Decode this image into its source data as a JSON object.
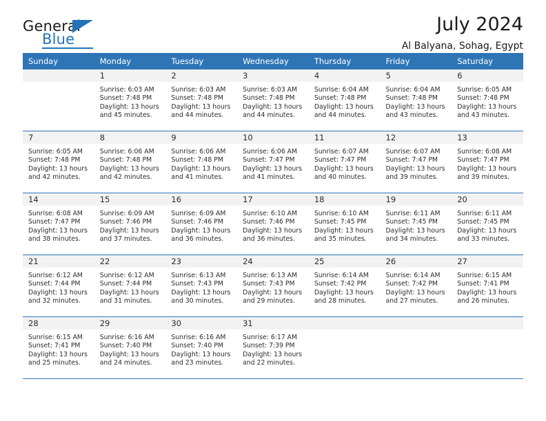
{
  "brand": {
    "name_part1": "General",
    "name_part2": "Blue",
    "accent_color": "#2272b8"
  },
  "header": {
    "title": "July 2024",
    "subtitle": "Al Balyana, Sohag, Egypt"
  },
  "calendar": {
    "header_color": "#2e75b6",
    "daynum_background": "#f2f2f2",
    "weekday_headers": [
      "Sunday",
      "Monday",
      "Tuesday",
      "Wednesday",
      "Thursday",
      "Friday",
      "Saturday"
    ],
    "weeks": [
      [
        {
          "day": "",
          "sunrise": "",
          "sunset": "",
          "daylight1": "",
          "daylight2": ""
        },
        {
          "day": "1",
          "sunrise": "Sunrise: 6:03 AM",
          "sunset": "Sunset: 7:48 PM",
          "daylight1": "Daylight: 13 hours",
          "daylight2": "and 45 minutes."
        },
        {
          "day": "2",
          "sunrise": "Sunrise: 6:03 AM",
          "sunset": "Sunset: 7:48 PM",
          "daylight1": "Daylight: 13 hours",
          "daylight2": "and 44 minutes."
        },
        {
          "day": "3",
          "sunrise": "Sunrise: 6:03 AM",
          "sunset": "Sunset: 7:48 PM",
          "daylight1": "Daylight: 13 hours",
          "daylight2": "and 44 minutes."
        },
        {
          "day": "4",
          "sunrise": "Sunrise: 6:04 AM",
          "sunset": "Sunset: 7:48 PM",
          "daylight1": "Daylight: 13 hours",
          "daylight2": "and 44 minutes."
        },
        {
          "day": "5",
          "sunrise": "Sunrise: 6:04 AM",
          "sunset": "Sunset: 7:48 PM",
          "daylight1": "Daylight: 13 hours",
          "daylight2": "and 43 minutes."
        },
        {
          "day": "6",
          "sunrise": "Sunrise: 6:05 AM",
          "sunset": "Sunset: 7:48 PM",
          "daylight1": "Daylight: 13 hours",
          "daylight2": "and 43 minutes."
        }
      ],
      [
        {
          "day": "7",
          "sunrise": "Sunrise: 6:05 AM",
          "sunset": "Sunset: 7:48 PM",
          "daylight1": "Daylight: 13 hours",
          "daylight2": "and 42 minutes."
        },
        {
          "day": "8",
          "sunrise": "Sunrise: 6:06 AM",
          "sunset": "Sunset: 7:48 PM",
          "daylight1": "Daylight: 13 hours",
          "daylight2": "and 42 minutes."
        },
        {
          "day": "9",
          "sunrise": "Sunrise: 6:06 AM",
          "sunset": "Sunset: 7:48 PM",
          "daylight1": "Daylight: 13 hours",
          "daylight2": "and 41 minutes."
        },
        {
          "day": "10",
          "sunrise": "Sunrise: 6:06 AM",
          "sunset": "Sunset: 7:47 PM",
          "daylight1": "Daylight: 13 hours",
          "daylight2": "and 41 minutes."
        },
        {
          "day": "11",
          "sunrise": "Sunrise: 6:07 AM",
          "sunset": "Sunset: 7:47 PM",
          "daylight1": "Daylight: 13 hours",
          "daylight2": "and 40 minutes."
        },
        {
          "day": "12",
          "sunrise": "Sunrise: 6:07 AM",
          "sunset": "Sunset: 7:47 PM",
          "daylight1": "Daylight: 13 hours",
          "daylight2": "and 39 minutes."
        },
        {
          "day": "13",
          "sunrise": "Sunrise: 6:08 AM",
          "sunset": "Sunset: 7:47 PM",
          "daylight1": "Daylight: 13 hours",
          "daylight2": "and 39 minutes."
        }
      ],
      [
        {
          "day": "14",
          "sunrise": "Sunrise: 6:08 AM",
          "sunset": "Sunset: 7:47 PM",
          "daylight1": "Daylight: 13 hours",
          "daylight2": "and 38 minutes."
        },
        {
          "day": "15",
          "sunrise": "Sunrise: 6:09 AM",
          "sunset": "Sunset: 7:46 PM",
          "daylight1": "Daylight: 13 hours",
          "daylight2": "and 37 minutes."
        },
        {
          "day": "16",
          "sunrise": "Sunrise: 6:09 AM",
          "sunset": "Sunset: 7:46 PM",
          "daylight1": "Daylight: 13 hours",
          "daylight2": "and 36 minutes."
        },
        {
          "day": "17",
          "sunrise": "Sunrise: 6:10 AM",
          "sunset": "Sunset: 7:46 PM",
          "daylight1": "Daylight: 13 hours",
          "daylight2": "and 36 minutes."
        },
        {
          "day": "18",
          "sunrise": "Sunrise: 6:10 AM",
          "sunset": "Sunset: 7:45 PM",
          "daylight1": "Daylight: 13 hours",
          "daylight2": "and 35 minutes."
        },
        {
          "day": "19",
          "sunrise": "Sunrise: 6:11 AM",
          "sunset": "Sunset: 7:45 PM",
          "daylight1": "Daylight: 13 hours",
          "daylight2": "and 34 minutes."
        },
        {
          "day": "20",
          "sunrise": "Sunrise: 6:11 AM",
          "sunset": "Sunset: 7:45 PM",
          "daylight1": "Daylight: 13 hours",
          "daylight2": "and 33 minutes."
        }
      ],
      [
        {
          "day": "21",
          "sunrise": "Sunrise: 6:12 AM",
          "sunset": "Sunset: 7:44 PM",
          "daylight1": "Daylight: 13 hours",
          "daylight2": "and 32 minutes."
        },
        {
          "day": "22",
          "sunrise": "Sunrise: 6:12 AM",
          "sunset": "Sunset: 7:44 PM",
          "daylight1": "Daylight: 13 hours",
          "daylight2": "and 31 minutes."
        },
        {
          "day": "23",
          "sunrise": "Sunrise: 6:13 AM",
          "sunset": "Sunset: 7:43 PM",
          "daylight1": "Daylight: 13 hours",
          "daylight2": "and 30 minutes."
        },
        {
          "day": "24",
          "sunrise": "Sunrise: 6:13 AM",
          "sunset": "Sunset: 7:43 PM",
          "daylight1": "Daylight: 13 hours",
          "daylight2": "and 29 minutes."
        },
        {
          "day": "25",
          "sunrise": "Sunrise: 6:14 AM",
          "sunset": "Sunset: 7:42 PM",
          "daylight1": "Daylight: 13 hours",
          "daylight2": "and 28 minutes."
        },
        {
          "day": "26",
          "sunrise": "Sunrise: 6:14 AM",
          "sunset": "Sunset: 7:42 PM",
          "daylight1": "Daylight: 13 hours",
          "daylight2": "and 27 minutes."
        },
        {
          "day": "27",
          "sunrise": "Sunrise: 6:15 AM",
          "sunset": "Sunset: 7:41 PM",
          "daylight1": "Daylight: 13 hours",
          "daylight2": "and 26 minutes."
        }
      ],
      [
        {
          "day": "28",
          "sunrise": "Sunrise: 6:15 AM",
          "sunset": "Sunset: 7:41 PM",
          "daylight1": "Daylight: 13 hours",
          "daylight2": "and 25 minutes."
        },
        {
          "day": "29",
          "sunrise": "Sunrise: 6:16 AM",
          "sunset": "Sunset: 7:40 PM",
          "daylight1": "Daylight: 13 hours",
          "daylight2": "and 24 minutes."
        },
        {
          "day": "30",
          "sunrise": "Sunrise: 6:16 AM",
          "sunset": "Sunset: 7:40 PM",
          "daylight1": "Daylight: 13 hours",
          "daylight2": "and 23 minutes."
        },
        {
          "day": "31",
          "sunrise": "Sunrise: 6:17 AM",
          "sunset": "Sunset: 7:39 PM",
          "daylight1": "Daylight: 13 hours",
          "daylight2": "and 22 minutes."
        },
        {
          "day": "",
          "sunrise": "",
          "sunset": "",
          "daylight1": "",
          "daylight2": ""
        },
        {
          "day": "",
          "sunrise": "",
          "sunset": "",
          "daylight1": "",
          "daylight2": ""
        },
        {
          "day": "",
          "sunrise": "",
          "sunset": "",
          "daylight1": "",
          "daylight2": ""
        }
      ]
    ]
  }
}
